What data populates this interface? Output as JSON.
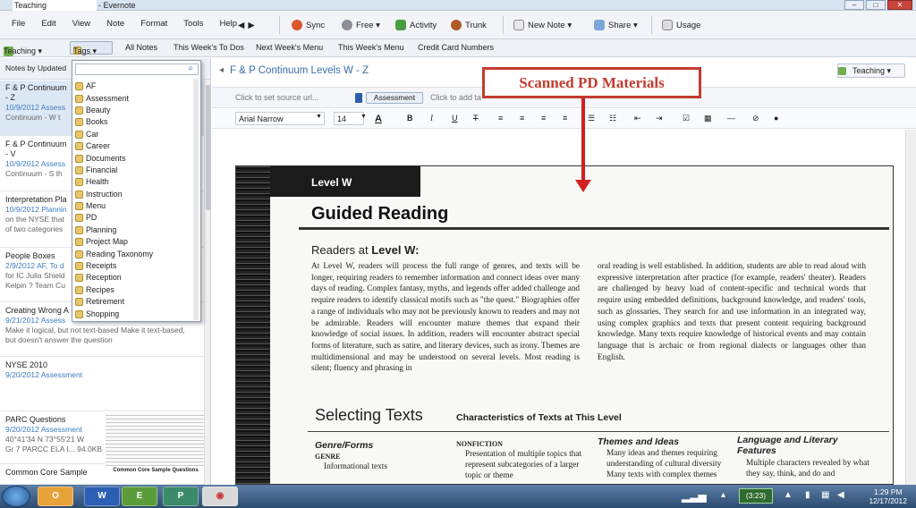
{
  "window": {
    "tab_title": "Teaching",
    "app_name": "- Evernote"
  },
  "menu": [
    "File",
    "Edit",
    "View",
    "Note",
    "Format",
    "Tools",
    "Help"
  ],
  "toolbar": {
    "sync": "Sync",
    "free": "Free ▾",
    "activity": "Activity",
    "trunk": "Trunk",
    "new_note": "New Note ▾",
    "share": "Share ▾",
    "usage": "Usage"
  },
  "secbar": {
    "notebook": "Teaching ▾",
    "tags": "Tags ▾",
    "shortcuts": [
      "All Notes",
      "This Week's To Dos",
      "Next Week's Menu",
      "This Week's Menu",
      "Credit Card Numbers"
    ]
  },
  "notelist": {
    "header": "Notes by Updated",
    "notes": [
      {
        "title": "F & P Continuum",
        "line2": "- Z",
        "date": "10/9/2012",
        "tag": "Assess",
        "snippet": "Continuum - W t"
      },
      {
        "title": "F & P Continuum",
        "line2": "- V",
        "date": "10/9/2012",
        "tag": "Assess",
        "snippet": "Continuum - S th"
      },
      {
        "title": "Interpretation Pla",
        "date": "10/9/2012",
        "tag": "Plannin",
        "snippet": "on the NYSE that",
        "snippet2": "of two categories"
      },
      {
        "title": "People Boxes",
        "date": "2/9/2012",
        "tag": "AF, To d",
        "snippet": "for IC Julia Shield",
        "snippet2": "Kelpin ? Team Cu"
      },
      {
        "title": "Creating Wrong A",
        "date": "9/21/2012",
        "tag": "Assess",
        "snippet": "Make it logical, but not text-based Make it text-based,",
        "snippet2": "but doesn't answer the question"
      },
      {
        "title": "NYSE 2010",
        "date": "9/20/2012",
        "tag": "Assessment"
      },
      {
        "title": "PARC Questions",
        "date": "9/20/2012",
        "tag": "Assessment",
        "snippet": "40°41'34 N 73°55'21 W",
        "snippet2": "Gr 7 PARCC ELA I... 94.0KB"
      },
      {
        "title": "Common Core Sample",
        "thumb_caption": "Common Core Sample Questions"
      }
    ]
  },
  "tags_popup": [
    "AF",
    "Assessment",
    "Beauty",
    "Books",
    "Car",
    "Career",
    "Documents",
    "Financial",
    "Health",
    "Instruction",
    "Menu",
    "PD",
    "Planning",
    "Project Map",
    "Reading Taxonomy",
    "Receipts",
    "Reception",
    "Recipes",
    "Retirement",
    "Shopping"
  ],
  "editor": {
    "title": "F & P Continuum Levels W - Z",
    "notebook": "Teaching ▾",
    "source_placeholder": "Click to set source url...",
    "tag": "Assessment",
    "add_tag": "Click to add ta",
    "font": "Arial Narrow",
    "size": "14",
    "format_buttons": [
      "A",
      "B",
      "I",
      "U",
      "T"
    ]
  },
  "annotation": "Scanned PD Materials",
  "scan": {
    "level_banner": "Level W",
    "heading": "Guided Reading",
    "readers_at": "Readers at",
    "level_bold": "Level W:",
    "col1": "At Level W, readers will process the full range of genres, and texts will be longer, requiring readers to remember information and connect ideas over many days of reading. Complex fantasy, myths, and legends offer added challenge and require readers to identify classical motifs such as \"the quest.\" Biographies offer a range of individuals who may not be previously known to readers and may not be admirable. Readers will encounter mature themes that expand their knowledge of social issues. In addition, readers will encounter abstract special forms of literature, such as satire, and literary devices, such as irony. Themes are multidimensional and may be understood on several levels. Most reading is silent; fluency and phrasing in",
    "col2": "oral reading is well established. In addition, students are able to read aloud with expressive interpretation after practice (for example, readers' theater). Readers are challenged by heavy load of content-specific and technical words that require using embedded definitions, background knowledge, and readers' tools, such as glossaries. They search for and use information in an integrated way, using complex graphics and texts that present content requiring background knowledge. Many texts require knowledge of historical events and may contain language that is archaic or from regional dialects or languages other than English.",
    "selecting": "Selecting Texts",
    "characteristics": "Characteristics of Texts at This Level",
    "genre_form": "Genre/Forms",
    "genre": "Genre",
    "genre_item": "Informational texts",
    "nonfiction": "Nonfiction",
    "nonfiction_text": "Presentation of multiple topics that represent subcategories of a larger topic or theme",
    "themes": "Themes and Ideas",
    "themes_text": "Many ideas and themes requiring understanding of cultural diversity Many texts with complex themes",
    "language": "Language and Literary Features",
    "language_text": "Multiple characters revealed by what they say, think, and do and"
  },
  "taskbar": {
    "battery": "(3:23)",
    "time": "1:29 PM",
    "date": "12/17/2012"
  }
}
